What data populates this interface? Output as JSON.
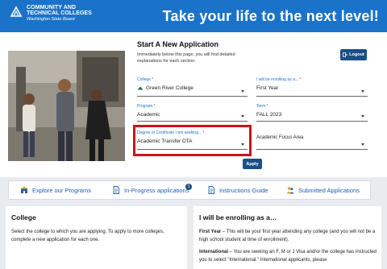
{
  "header": {
    "logo_line1": "COMMUNITY AND",
    "logo_line2": "TECHNICAL COLLEGES",
    "logo_line3": "Washington State Board",
    "tagline": "Take your life to the next level!"
  },
  "form": {
    "title": "Start A New Application",
    "subtitle": "Immediately below this page, you will find detailed explanations for each section.",
    "logout_label": "Logout",
    "college": {
      "label": "College",
      "value": "Green River College"
    },
    "enrolling": {
      "label": "I will be enrolling as a...",
      "value": "First Year"
    },
    "program": {
      "label": "Program",
      "value": "Academic"
    },
    "term": {
      "label": "Term",
      "value": "FALL 2023"
    },
    "degree": {
      "label": "Degree or Certificate I am seeking...",
      "value": "Academic Transfer DTA"
    },
    "focus": {
      "label": "Academic Focus Area",
      "value": ""
    },
    "apply_label": "Apply",
    "required_mark": "*"
  },
  "tabs": [
    {
      "label": "Explore our Programs",
      "icon": "building-icon"
    },
    {
      "label": "In-Progress applications",
      "icon": "document-icon",
      "badge": "1"
    },
    {
      "label": "Instructions Guide",
      "icon": "document-icon"
    },
    {
      "label": "Submitted Applications",
      "icon": "people-icon"
    }
  ],
  "college_panel": {
    "title": "College",
    "text": "Select the college to which you are applying. To apply to more colleges, complete a new application for each one."
  },
  "enrolling_panel": {
    "title": "I will be enrolling as a…",
    "first_year_term": "First Year",
    "first_year_text": " – This will be your first year attending any college (and you will not be a high school student at time of enrollment).",
    "international_term": "International",
    "international_text": " – You are seeking an F, M or J Visa and/or the college has instructed you to select “International.” International applicants, please"
  },
  "colors": {
    "header_blue": "#1a73c9",
    "button_navy": "#1a4f86",
    "highlight_red": "#c9151b",
    "link_blue": "#1a5fb4"
  }
}
